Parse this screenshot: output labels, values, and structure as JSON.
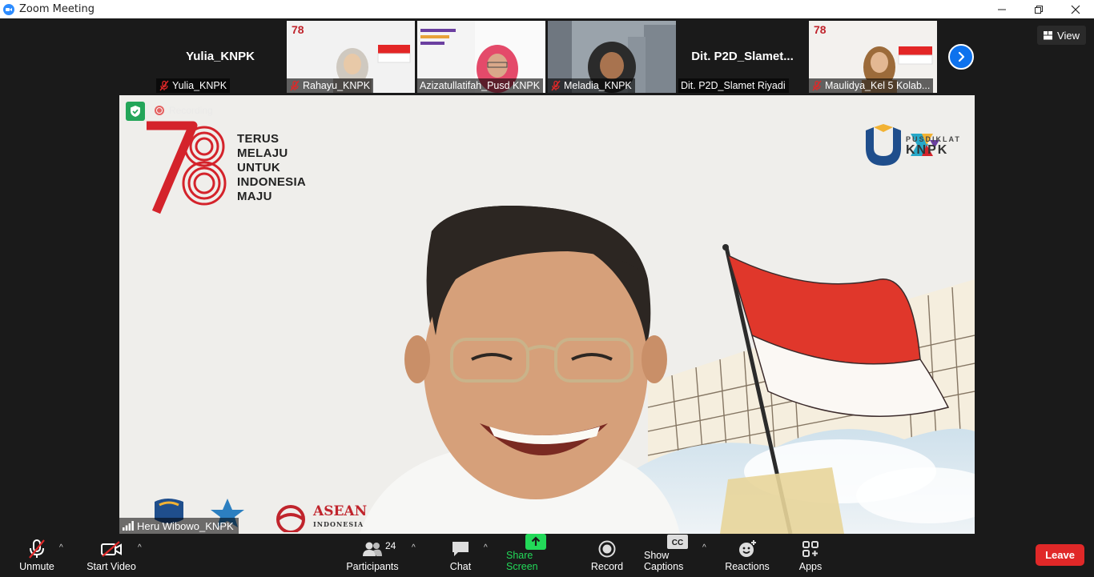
{
  "window": {
    "title": "Zoom Meeting"
  },
  "view_button": {
    "label": "View"
  },
  "participants_strip": [
    {
      "display": "Yulia_KNPK",
      "label": "Yulia_KNPK",
      "video": false,
      "muted": true
    },
    {
      "display": "",
      "label": "Rahayu_KNPK",
      "video": true,
      "muted": true
    },
    {
      "display": "",
      "label": "Azizatullatifah_Pusd KNPK",
      "video": true,
      "muted": false
    },
    {
      "display": "",
      "label": "Meladia_KNPK",
      "video": true,
      "muted": true
    },
    {
      "display": "Dit. P2D_Slamet...",
      "label": "Dit. P2D_Slamet Riyadi",
      "video": false,
      "muted": false
    },
    {
      "display": "",
      "label": "Maulidya_Kel 5 Kolab...",
      "video": true,
      "muted": true
    }
  ],
  "main_video": {
    "recording_label": "Recording",
    "slogan": [
      "TERUS",
      "MELAJU",
      "UNTUK",
      "INDONESIA",
      "MAJU"
    ],
    "logo_number": "78",
    "org_logo_small": "PUSDIKLAT",
    "org_logo_big": "KNPK",
    "asean_big": "ASEAN",
    "asean_small": "INDONESIA",
    "speaker_name": "Heru Wibowo_KNPK"
  },
  "toolbar": {
    "unmute": "Unmute",
    "start_video": "Start Video",
    "participants": "Participants",
    "participant_count": "24",
    "chat": "Chat",
    "share_screen": "Share Screen",
    "record": "Record",
    "show_captions": "Show Captions",
    "captions_icon_text": "CC",
    "reactions": "Reactions",
    "apps": "Apps",
    "leave": "Leave"
  },
  "colors": {
    "accent_blue": "#0e72ed",
    "leave_red": "#e02828",
    "share_green": "#23d959"
  }
}
